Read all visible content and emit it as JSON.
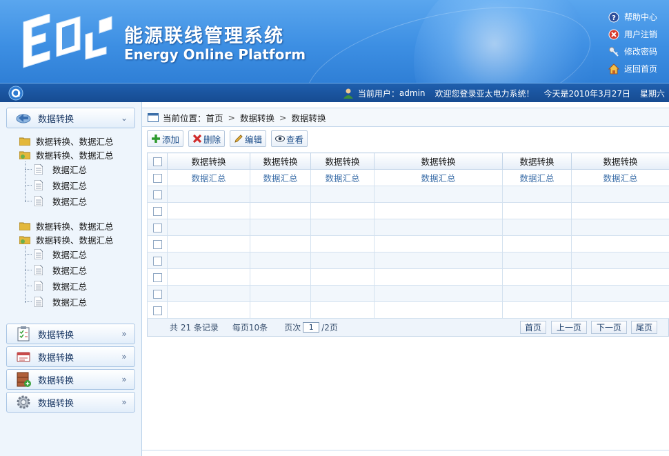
{
  "header": {
    "title_cn": "能源联线管理系统",
    "title_en": "Energy Online Platform",
    "logo_icon": "eol-logo",
    "links": [
      {
        "label": "帮助中心",
        "icon": "help-icon"
      },
      {
        "label": "用户注销",
        "icon": "logout-icon"
      },
      {
        "label": "修改密码",
        "icon": "key-icon"
      },
      {
        "label": "返回首页",
        "icon": "home-icon"
      }
    ]
  },
  "statusbar": {
    "current_user_label": "当前用户：",
    "current_user": "admin",
    "welcome": "欢迎您登录亚太电力系统！",
    "date": "今天是2010年3月27日",
    "weekday": "星期六"
  },
  "sidebar": {
    "sections": [
      {
        "label": "数据转换",
        "icon": "transfer-icon",
        "arrow": "⌄"
      },
      {
        "label": "数据转换",
        "icon": "checklist-icon",
        "arrow": "»"
      },
      {
        "label": "数据转换",
        "icon": "card-icon",
        "arrow": "»"
      },
      {
        "label": "数据转换",
        "icon": "cabinet-icon",
        "arrow": "»"
      },
      {
        "label": "数据转换",
        "icon": "gear-icon",
        "arrow": "»"
      }
    ],
    "tree": {
      "group1": {
        "folder_a": "数据转换、数据汇总",
        "folder_b": "数据转换、数据汇总",
        "leaves": [
          "数据汇总",
          "数据汇总",
          "数据汇总"
        ]
      },
      "group2": {
        "folder_a": "数据转换、数据汇总",
        "folder_b": "数据转换、数据汇总",
        "leaves": [
          "数据汇总",
          "数据汇总",
          "数据汇总",
          "数据汇总"
        ]
      }
    }
  },
  "breadcrumb": {
    "label": "当前位置：",
    "items": [
      "首页",
      "数据转换",
      "数据转换"
    ],
    "separator": ">"
  },
  "toolbar": {
    "add": "添加",
    "delete": "删除",
    "edit": "编辑",
    "view": "查看"
  },
  "table": {
    "headers": [
      "数据转换",
      "数据转换",
      "数据转换",
      "数据转换",
      "数据转换",
      "数据转换"
    ],
    "rows": [
      [
        "数据汇总",
        "数据汇总",
        "数据汇总",
        "数据汇总",
        "数据汇总",
        "数据汇总"
      ],
      [
        "",
        "",
        "",
        "",
        "",
        ""
      ],
      [
        "",
        "",
        "",
        "",
        "",
        ""
      ],
      [
        "",
        "",
        "",
        "",
        "",
        ""
      ],
      [
        "",
        "",
        "",
        "",
        "",
        ""
      ],
      [
        "",
        "",
        "",
        "",
        "",
        ""
      ],
      [
        "",
        "",
        "",
        "",
        "",
        ""
      ],
      [
        "",
        "",
        "",
        "",
        "",
        ""
      ],
      [
        "",
        "",
        "",
        "",
        "",
        ""
      ]
    ]
  },
  "pager": {
    "total": "共 21 条记录",
    "per_page": "每页10条",
    "page_label": "页次",
    "page_value": "1",
    "page_total": "/2页",
    "first": "首页",
    "prev": "上一页",
    "next": "下一页",
    "last": "尾页"
  },
  "colors": {
    "header_blue": "#3d8fe3",
    "status_bar": "#164b91",
    "link_blue": "#3b6ea8"
  }
}
